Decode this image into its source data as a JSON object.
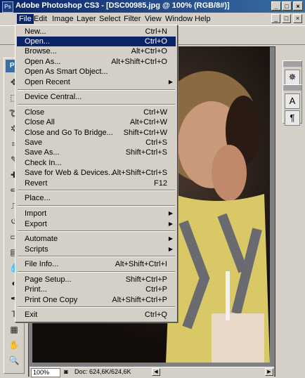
{
  "window": {
    "title": "Adobe Photoshop CS3 - [DSC00985.jpg @ 100% (RGB/8#)]",
    "app_icon": "Ps",
    "controls": [
      "_",
      "□",
      "×"
    ]
  },
  "menubar": {
    "items": [
      "File",
      "Edit",
      "Image",
      "Layer",
      "Select",
      "Filter",
      "View",
      "Window",
      "Help"
    ],
    "active": "File",
    "doc_controls": [
      "_",
      "□",
      "×"
    ]
  },
  "toolbox": {
    "header": "Ps"
  },
  "file_menu": {
    "items": [
      {
        "label": "New...",
        "shortcut": "Ctrl+N"
      },
      {
        "label": "Open...",
        "shortcut": "Ctrl+O",
        "highlighted": true
      },
      {
        "label": "Browse...",
        "shortcut": "Alt+Ctrl+O"
      },
      {
        "label": "Open As...",
        "shortcut": "Alt+Shift+Ctrl+O"
      },
      {
        "label": "Open As Smart Object...",
        "shortcut": ""
      },
      {
        "label": "Open Recent",
        "shortcut": "",
        "submenu": true
      },
      {
        "label": "Device Central...",
        "shortcut": ""
      },
      {
        "label": "Close",
        "shortcut": "Ctrl+W"
      },
      {
        "label": "Close All",
        "shortcut": "Alt+Ctrl+W"
      },
      {
        "label": "Close and Go To Bridge...",
        "shortcut": "Shift+Ctrl+W"
      },
      {
        "label": "Save",
        "shortcut": "Ctrl+S"
      },
      {
        "label": "Save As...",
        "shortcut": "Shift+Ctrl+S"
      },
      {
        "label": "Check In...",
        "shortcut": ""
      },
      {
        "label": "Save for Web & Devices...",
        "shortcut": "Alt+Shift+Ctrl+S"
      },
      {
        "label": "Revert",
        "shortcut": "F12"
      },
      {
        "label": "Place...",
        "shortcut": ""
      },
      {
        "label": "Import",
        "shortcut": "",
        "submenu": true
      },
      {
        "label": "Export",
        "shortcut": "",
        "submenu": true
      },
      {
        "label": "Automate",
        "shortcut": "",
        "submenu": true
      },
      {
        "label": "Scripts",
        "shortcut": "",
        "submenu": true
      },
      {
        "label": "File Info...",
        "shortcut": "Alt+Shift+Ctrl+I"
      },
      {
        "label": "Page Setup...",
        "shortcut": "Shift+Ctrl+P"
      },
      {
        "label": "Print...",
        "shortcut": "Ctrl+P"
      },
      {
        "label": "Print One Copy",
        "shortcut": "Alt+Shift+Ctrl+P"
      },
      {
        "label": "Exit",
        "shortcut": "Ctrl+Q"
      }
    ]
  },
  "status": {
    "zoom": "100%",
    "doc_info": "Doc: 624,6K/624,6K"
  },
  "right_panel": {
    "text_tool": "A",
    "paragraph": "¶"
  }
}
